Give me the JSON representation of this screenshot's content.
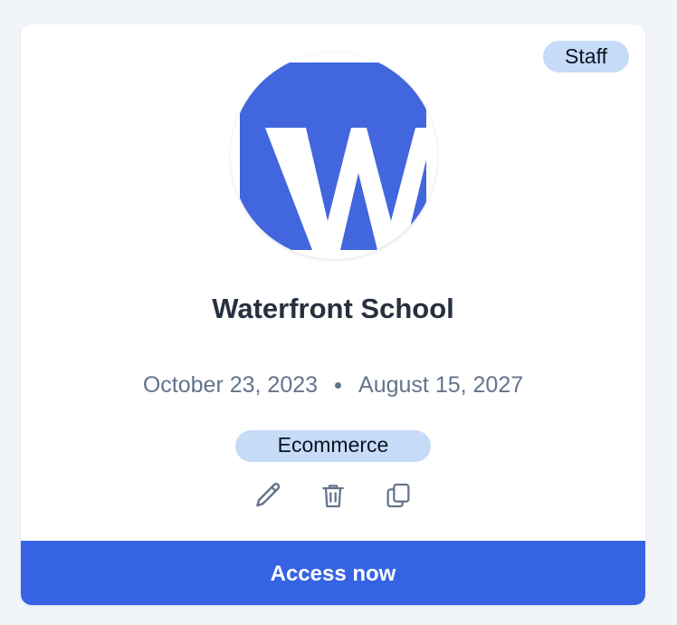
{
  "card": {
    "role_badge": "Staff",
    "logo": {
      "icon": "w-logo-icon",
      "letter": "W",
      "background_color": "#4266dd"
    },
    "school_name": "Waterfront School",
    "start_date": "October 23, 2023",
    "end_date": "August 15, 2027",
    "category": "Ecommerce",
    "actions": {
      "edit_icon": "pencil-icon",
      "delete_icon": "trash-icon",
      "duplicate_icon": "copy-icon"
    },
    "access_button_label": "Access now"
  },
  "colors": {
    "accent": "#3563e3",
    "badge_bg": "#c6dbf8",
    "title": "#27303f",
    "muted": "#64748b"
  }
}
